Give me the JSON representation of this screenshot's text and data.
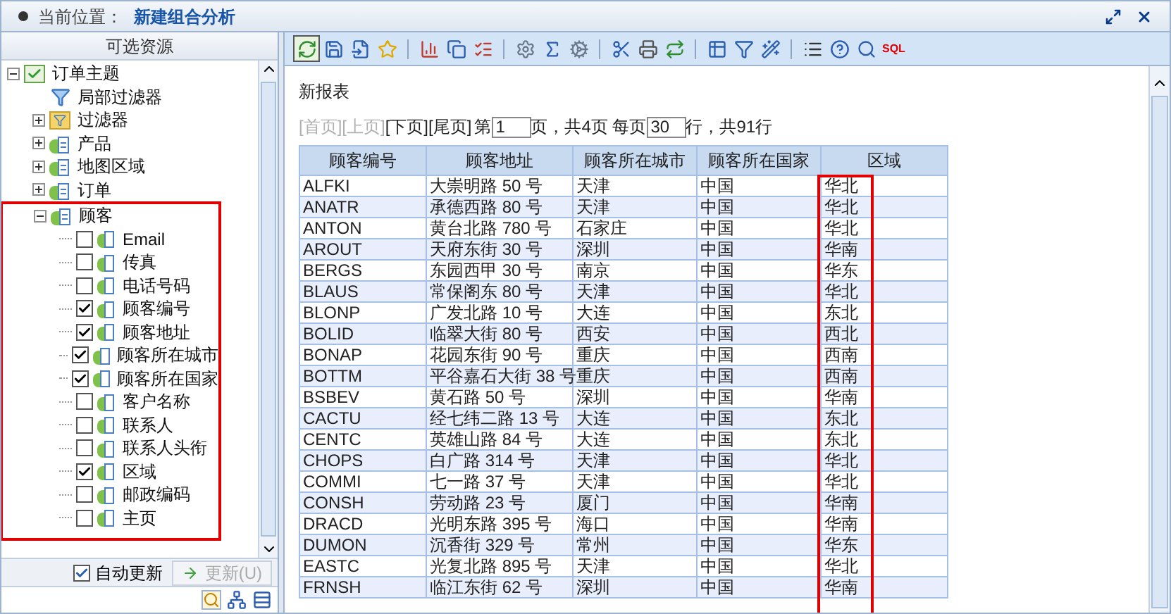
{
  "header": {
    "location_label": "当前位置：",
    "location_value": "新建组合分析"
  },
  "left_panel": {
    "title": "可选资源",
    "tree": [
      {
        "label": "订单主题",
        "kind": "subject",
        "expanded": true,
        "children": [
          {
            "label": "局部过滤器",
            "kind": "filter"
          },
          {
            "label": "过滤器",
            "kind": "folder",
            "expanded": false
          },
          {
            "label": "产品",
            "kind": "table",
            "expanded": false
          },
          {
            "label": "地图区域",
            "kind": "table",
            "expanded": false
          },
          {
            "label": "订单",
            "kind": "table",
            "expanded": false
          },
          {
            "label": "顾客",
            "kind": "table",
            "expanded": true,
            "highlighted": true,
            "children": [
              {
                "label": "Email",
                "kind": "field",
                "checked": false
              },
              {
                "label": "传真",
                "kind": "field",
                "checked": false
              },
              {
                "label": "电话号码",
                "kind": "field",
                "checked": false
              },
              {
                "label": "顾客编号",
                "kind": "field",
                "checked": true
              },
              {
                "label": "顾客地址",
                "kind": "field",
                "checked": true
              },
              {
                "label": "顾客所在城市",
                "kind": "field",
                "checked": true
              },
              {
                "label": "顾客所在国家",
                "kind": "field",
                "checked": true
              },
              {
                "label": "客户名称",
                "kind": "field",
                "checked": false
              },
              {
                "label": "联系人",
                "kind": "field",
                "checked": false
              },
              {
                "label": "联系人头衔",
                "kind": "field",
                "checked": false
              },
              {
                "label": "区域",
                "kind": "field",
                "checked": true
              },
              {
                "label": "邮政编码",
                "kind": "field",
                "checked": false
              },
              {
                "label": "主页",
                "kind": "field",
                "checked": false
              }
            ]
          }
        ]
      }
    ],
    "auto_update": {
      "label": "自动更新",
      "checked": true
    },
    "update_button": {
      "label": "更新(U)",
      "disabled": true
    }
  },
  "toolbar": {
    "sql_label": "SQL"
  },
  "report": {
    "title": "新报表",
    "pager": {
      "links": [
        {
          "label": "[首页]",
          "disabled": true
        },
        {
          "label": "[上页]",
          "disabled": true
        },
        {
          "label": "[下页]",
          "disabled": false
        },
        {
          "label": "[尾页]",
          "disabled": false
        }
      ],
      "page_prefix": "第",
      "page_value": "1",
      "page_suffix": "页，共4页 每页",
      "rows_value": "30",
      "rows_suffix": "行，共91行"
    },
    "table": {
      "columns": [
        {
          "label": "顾客编号",
          "highlighted": false
        },
        {
          "label": "顾客地址",
          "highlighted": false
        },
        {
          "label": "顾客所在城市",
          "highlighted": false
        },
        {
          "label": "顾客所在国家",
          "highlighted": false
        },
        {
          "label": "区域",
          "highlighted": true
        }
      ],
      "rows": [
        [
          "ALFKI",
          "大崇明路 50 号",
          "天津",
          "中国",
          "华北"
        ],
        [
          "ANATR",
          "承德西路 80 号",
          "天津",
          "中国",
          "华北"
        ],
        [
          "ANTON",
          "黄台北路 780 号",
          "石家庄",
          "中国",
          "华北"
        ],
        [
          "AROUT",
          "天府东街 30 号",
          "深圳",
          "中国",
          "华南"
        ],
        [
          "BERGS",
          "东园西甲 30 号",
          "南京",
          "中国",
          "华东"
        ],
        [
          "BLAUS",
          "常保阁东 80 号",
          "天津",
          "中国",
          "华北"
        ],
        [
          "BLONP",
          "广发北路 10 号",
          "大连",
          "中国",
          "东北"
        ],
        [
          "BOLID",
          "临翠大街 80 号",
          "西安",
          "中国",
          "西北"
        ],
        [
          "BONAP",
          "花园东街 90 号",
          "重庆",
          "中国",
          "西南"
        ],
        [
          "BOTTM",
          "平谷嘉石大街 38 号",
          "重庆",
          "中国",
          "西南"
        ],
        [
          "BSBEV",
          "黄石路 50 号",
          "深圳",
          "中国",
          "华南"
        ],
        [
          "CACTU",
          "经七纬二路 13 号",
          "大连",
          "中国",
          "东北"
        ],
        [
          "CENTC",
          "英雄山路 84 号",
          "大连",
          "中国",
          "东北"
        ],
        [
          "CHOPS",
          "白广路 314 号",
          "天津",
          "中国",
          "华北"
        ],
        [
          "COMMI",
          "七一路 37 号",
          "天津",
          "中国",
          "华北"
        ],
        [
          "CONSH",
          "劳动路 23 号",
          "厦门",
          "中国",
          "华南"
        ],
        [
          "DRACD",
          "光明东路 395 号",
          "海口",
          "中国",
          "华南"
        ],
        [
          "DUMON",
          "沉香街 329 号",
          "常州",
          "中国",
          "华东"
        ],
        [
          "EASTC",
          "光复北路 895 号",
          "天津",
          "中国",
          "华北"
        ],
        [
          "FRNSH",
          "临江东街 62 号",
          "深圳",
          "中国",
          "华南"
        ]
      ]
    }
  }
}
